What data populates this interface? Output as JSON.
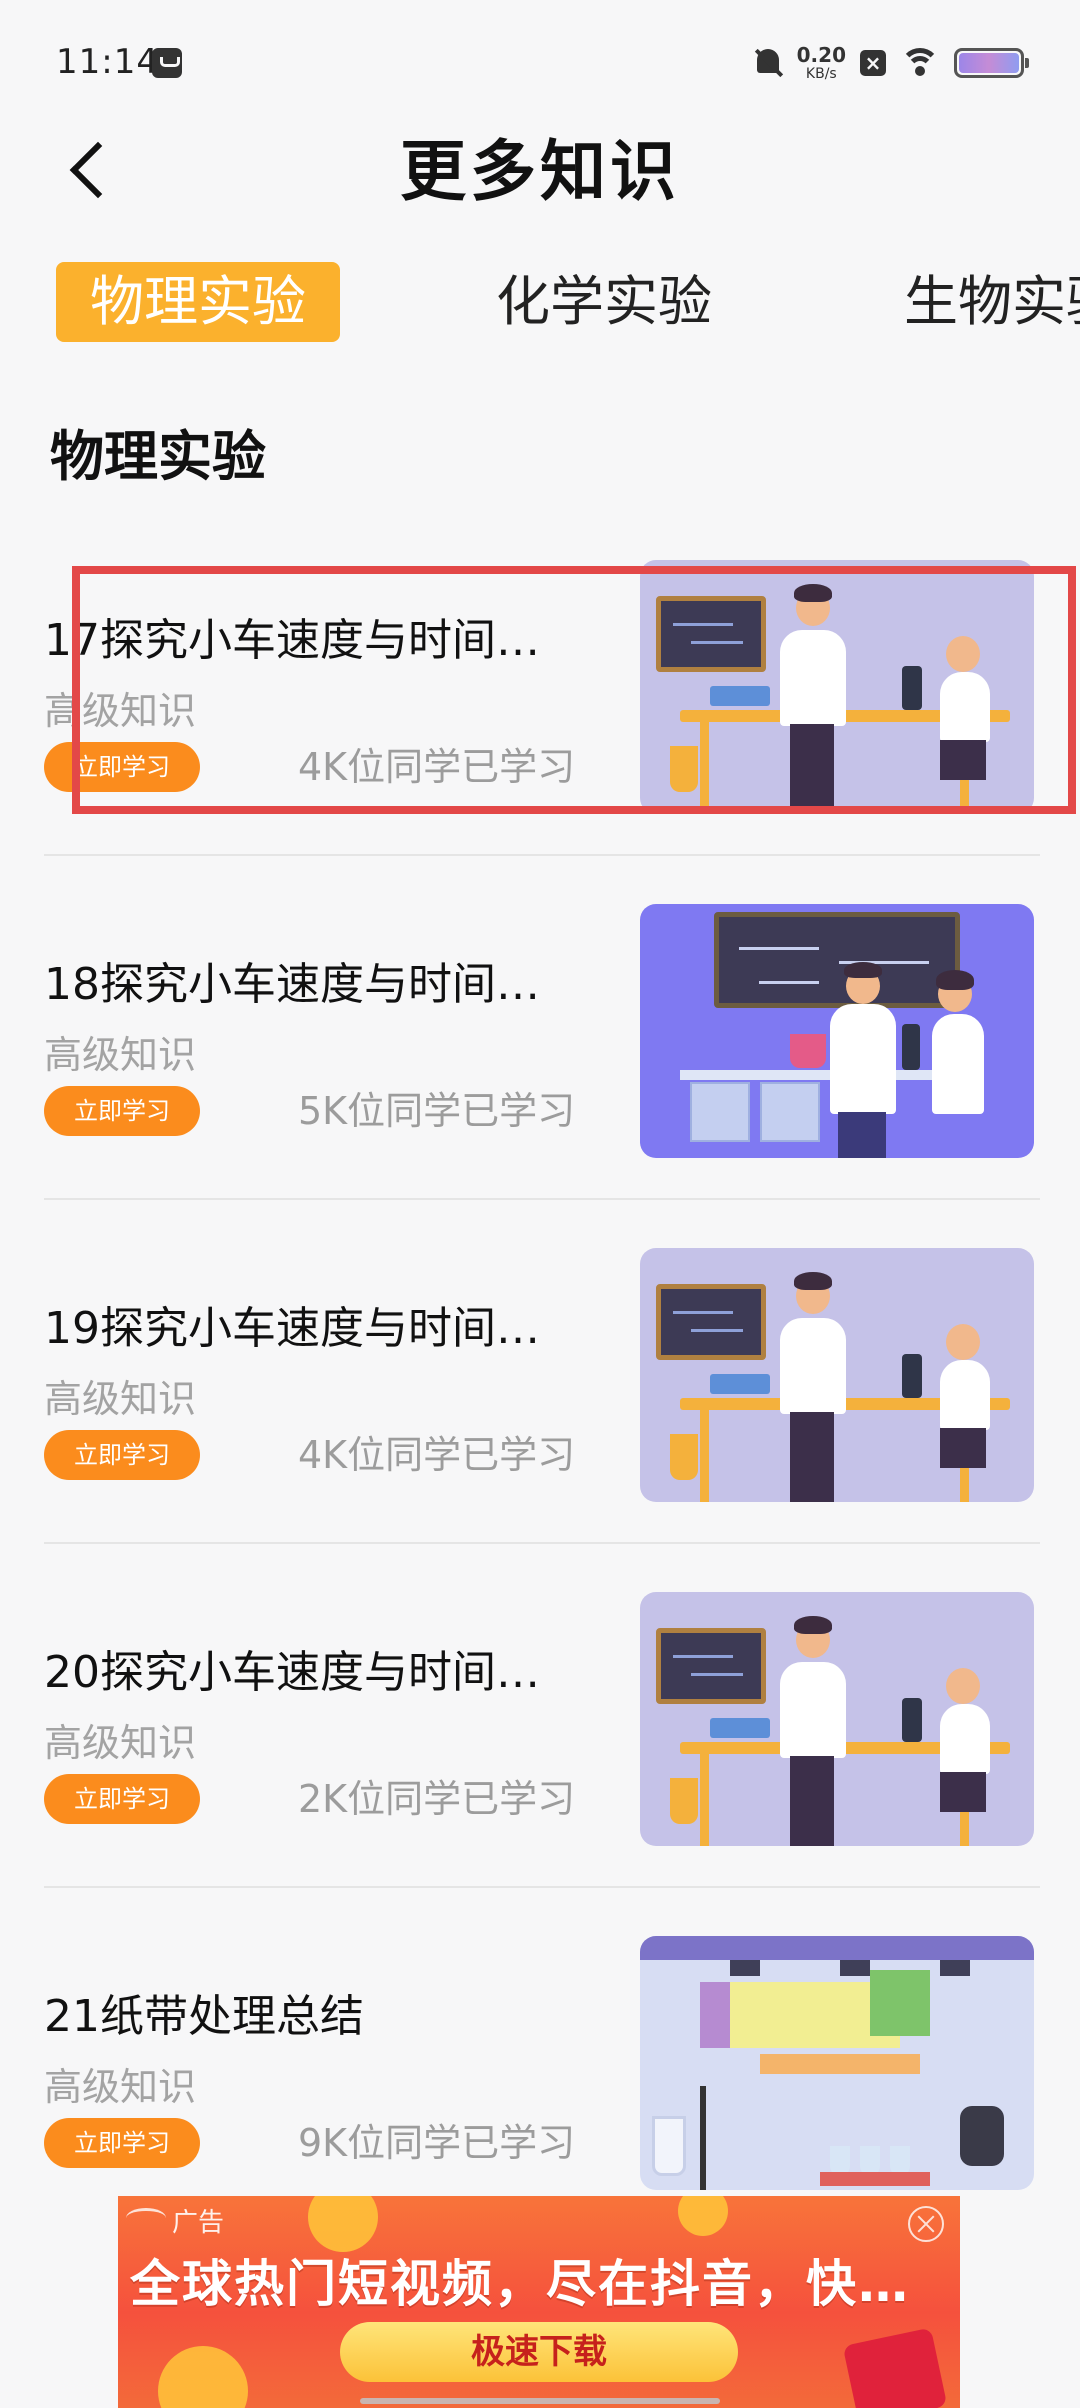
{
  "status_bar": {
    "time": "11:14",
    "net_speed_value": "0.20",
    "net_speed_unit": "KB/s"
  },
  "header": {
    "title": "更多知识"
  },
  "tabs": [
    {
      "label": "物理实验",
      "active": true
    },
    {
      "label": "化学实验",
      "active": false
    },
    {
      "label": "生物实验",
      "active": false
    }
  ],
  "section": {
    "title": "物理实验"
  },
  "items": [
    {
      "title": "17探究小车速度与时间…",
      "level": "高级知识",
      "button": "立即学习",
      "learners": "4K位同学已学习",
      "thumbnail": "lab-scientists-illustration"
    },
    {
      "title": "18探究小车速度与时间…",
      "level": "高级知识",
      "button": "立即学习",
      "learners": "5K位同学已学习",
      "thumbnail": "lab-blackboard-illustration"
    },
    {
      "title": "19探究小车速度与时间…",
      "level": "高级知识",
      "button": "立即学习",
      "learners": "4K位同学已学习",
      "thumbnail": "lab-scientists-illustration"
    },
    {
      "title": "20探究小车速度与时间…",
      "level": "高级知识",
      "button": "立即学习",
      "learners": "2K位同学已学习",
      "thumbnail": "lab-scientists-illustration"
    },
    {
      "title": "21纸带处理总结",
      "level": "高级知识",
      "button": "立即学习",
      "learners": "9K位同学已学习",
      "thumbnail": "lab-equipment-illustration"
    }
  ],
  "ad": {
    "label": "广告",
    "text": "全球热门短视频，尽在抖音，快…",
    "button": "极速下载"
  },
  "colors": {
    "accent_tab": "#fbb12d",
    "button_orange": "#fb8c1d",
    "highlight": "#e34848"
  }
}
